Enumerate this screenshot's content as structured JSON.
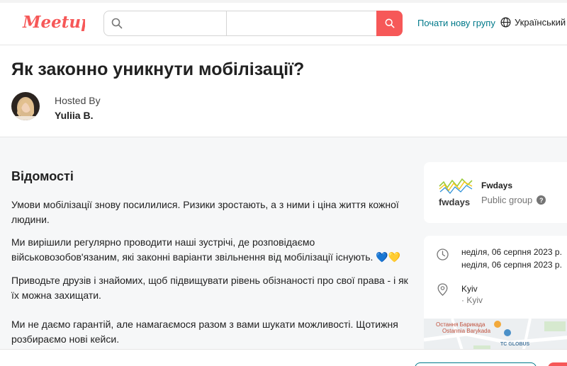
{
  "header": {
    "logo_text": "Meetup",
    "search_placeholder": "",
    "location_placeholder": "",
    "start_group_label": "Почати нову групу",
    "language_label": "Український"
  },
  "event": {
    "title": "Як законно уникнути мобілізації?",
    "hosted_by_label": "Hosted By",
    "host_name": "Yuliia B."
  },
  "details": {
    "heading": "Відомості",
    "paragraphs": [
      "Умови мобілізації знову посилилися. Ризики зростають, а з ними і ціна життя кожної людини.",
      "Ми вирішили регулярно проводити наші зустрічі, де розповідаємо військовозобов'язаним, які законні варіанти звільнення від мобілізації існують. 💙💛",
      "Приводьте друзів і знайомих, щоб підвищувати рівень обізнаності про свої права - і як їх можна захищати.",
      "Ми не даємо гарантій, але намагаємося разом з вами шукати можливості. Щотижня розбираємо нові кейси."
    ]
  },
  "group": {
    "logo_text": "fwdays",
    "name": "Fwdays",
    "type": "Public group"
  },
  "info": {
    "date_start": "неділя, 06 серпня 2023 р.",
    "date_end": "неділя, 06 серпня 2023 р.",
    "location_city": "Kyiv",
    "location_sub": "· Kyiv",
    "map_labels": [
      "Остання Барикада",
      "Ostannia Barykada",
      "TC GLOBUS"
    ]
  },
  "colors": {
    "brand_red": "#f65858",
    "teal_link": "#00798a",
    "page_gray": "#f6f7f8"
  }
}
